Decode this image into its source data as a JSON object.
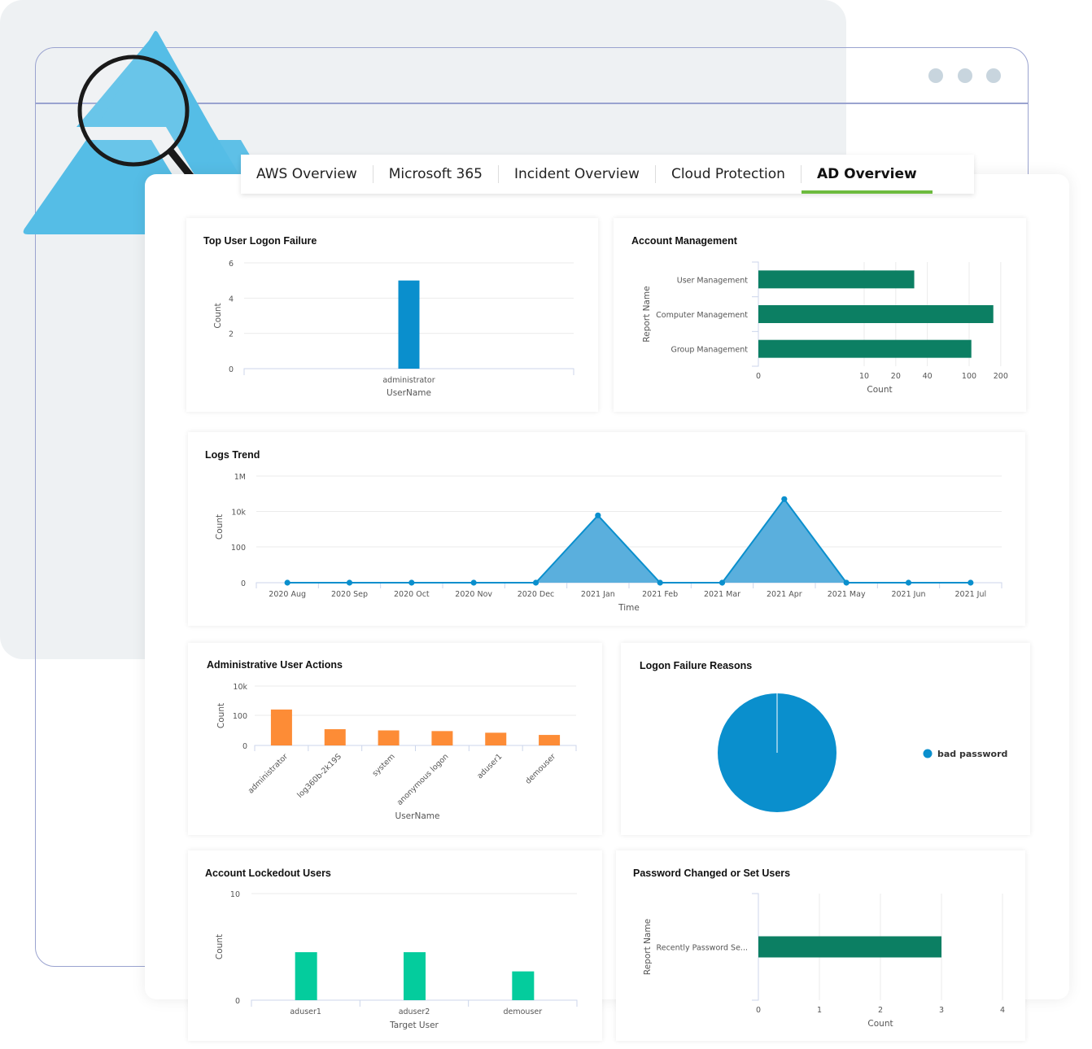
{
  "window": {
    "controls": [
      "dot",
      "dot",
      "dot"
    ]
  },
  "branding": {
    "logo_icon": "triangle-logo-icon",
    "magnifier_icon": "magnifying-glass-icon",
    "logo_color": "#55bde6"
  },
  "tabs": [
    {
      "label": "AWS Overview",
      "active": false
    },
    {
      "label": "Microsoft 365",
      "active": false
    },
    {
      "label": "Incident Overview",
      "active": false
    },
    {
      "label": "Cloud Protection",
      "active": false
    },
    {
      "label": "AD Overview",
      "active": true
    }
  ],
  "colors": {
    "active_tab_underline": "#6dbb3e",
    "blue": "#0a8fcd",
    "green_dark": "#0c7f63",
    "orange": "#fd8c36",
    "teal": "#04cc9d"
  },
  "chart_data": [
    {
      "id": "top-user-logon-failure",
      "type": "bar",
      "title": "Top User Logon Failure",
      "xlabel": "UserName",
      "ylabel": "Count",
      "categories": [
        "administrator"
      ],
      "values": [
        5
      ],
      "yticks": [
        "0",
        "2",
        "4",
        "6"
      ],
      "ylim": [
        0,
        6
      ],
      "grid": true,
      "color": "#0a8fcd"
    },
    {
      "id": "account-management",
      "type": "bar",
      "orientation": "horizontal",
      "title": "Account Management",
      "xlabel": "Count",
      "ylabel": "Report Name",
      "categories": [
        "User Management",
        "Computer Management",
        "Group Management"
      ],
      "values": [
        30,
        170,
        105
      ],
      "xscale": "log",
      "xticks": [
        "0",
        "10",
        "20",
        "40",
        "100",
        "200"
      ],
      "grid": true,
      "color": "#0c7f63"
    },
    {
      "id": "logs-trend",
      "type": "area",
      "title": "Logs Trend",
      "xlabel": "Time",
      "ylabel": "Count",
      "categories": [
        "2020 Aug",
        "2020 Sep",
        "2020 Oct",
        "2020 Nov",
        "2020 Dec",
        "2021 Jan",
        "2021 Feb",
        "2021 Mar",
        "2021 Apr",
        "2021 May",
        "2021 Jun",
        "2021 Jul"
      ],
      "values": [
        0,
        0,
        0,
        0,
        0,
        6000,
        0,
        0,
        50000,
        0,
        0,
        0
      ],
      "yscale": "log",
      "yticks": [
        "0",
        "100",
        "10k",
        "1M"
      ],
      "grid": true,
      "color": "#0a8fcd"
    },
    {
      "id": "administrative-user-actions",
      "type": "bar",
      "title": "Administrative User Actions",
      "xlabel": "UserName",
      "ylabel": "Count",
      "categories": [
        "administrator",
        "log360b-2k19S",
        "system",
        "anonymous logon",
        "aduser1",
        "demouser"
      ],
      "values": [
        250,
        12,
        10,
        9,
        7,
        5
      ],
      "yscale": "log",
      "yticks": [
        "0",
        "100",
        "10k"
      ],
      "grid": true,
      "color": "#fd8c36"
    },
    {
      "id": "logon-failure-reasons",
      "type": "pie",
      "title": "Logon Failure Reasons",
      "labels": [
        "bad password"
      ],
      "values": [
        100
      ],
      "legend": "right",
      "color": "#0a8fcd"
    },
    {
      "id": "account-lockedout-users",
      "type": "bar",
      "title": "Account Lockedout Users",
      "xlabel": "Target User",
      "ylabel": "Count",
      "categories": [
        "aduser1",
        "aduser2",
        "demouser"
      ],
      "values": [
        4.5,
        4.5,
        2.7
      ],
      "yticks": [
        "0",
        "10"
      ],
      "ylim": [
        0,
        10
      ],
      "grid": true,
      "color": "#04cc9d"
    },
    {
      "id": "password-changed-or-set-users",
      "type": "bar",
      "orientation": "horizontal",
      "title": "Password Changed or Set Users",
      "xlabel": "Count",
      "ylabel": "Report Name",
      "categories": [
        "Recently Password Se..."
      ],
      "values": [
        3
      ],
      "xticks": [
        "0",
        "1",
        "2",
        "3",
        "4"
      ],
      "xlim": [
        0,
        4
      ],
      "grid": true,
      "color": "#0c7f63"
    }
  ]
}
